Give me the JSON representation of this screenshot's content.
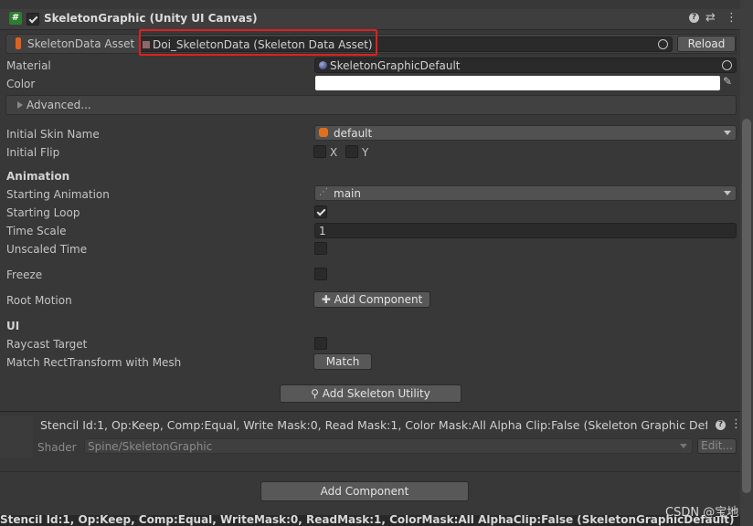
{
  "header": {
    "component_title": "SkeletonGraphic (Unity UI Canvas)",
    "enabled": true,
    "help_icon": "help-icon",
    "preset_icon": "preset-icon",
    "menu_icon": "kebab-menu-icon"
  },
  "skeleton_data": {
    "label": "SkeletonData Asset",
    "value": "Doi_SkeletonData (Skeleton Data Asset)",
    "reload_label": "Reload"
  },
  "material": {
    "label": "Material",
    "value": "SkeletonGraphicDefault"
  },
  "color": {
    "label": "Color",
    "value": "#ffffff"
  },
  "advanced": {
    "label": "Advanced..."
  },
  "skin": {
    "label": "Initial Skin Name",
    "value": "default"
  },
  "flip": {
    "label": "Initial Flip",
    "x_label": "X",
    "y_label": "Y"
  },
  "animation_section": {
    "title": "Animation"
  },
  "starting_animation": {
    "label": "Starting Animation",
    "value": "main"
  },
  "starting_loop": {
    "label": "Starting Loop",
    "checked": true
  },
  "time_scale": {
    "label": "Time Scale",
    "value": "1"
  },
  "unscaled_time": {
    "label": "Unscaled Time",
    "checked": false
  },
  "freeze": {
    "label": "Freeze",
    "checked": false
  },
  "root_motion": {
    "label": "Root Motion",
    "button_label": "Add Component"
  },
  "ui_section": {
    "title": "UI"
  },
  "raycast_target": {
    "label": "Raycast Target",
    "checked": false
  },
  "match_rect": {
    "label": "Match RectTransform with Mesh",
    "button_label": "Match"
  },
  "skeleton_utility": {
    "button_label": "Add Skeleton Utility"
  },
  "material_panel": {
    "title": "Stencil Id:1, Op:Keep, Comp:Equal, Write Mask:0, Read Mask:1, Color Mask:All Alpha Clip:False (Skeleton Graphic Def",
    "shader_label": "Shader",
    "shader_value": "Spine/SkeletonGraphic",
    "edit_label": "Edit..."
  },
  "add_component": {
    "label": "Add Component"
  },
  "footer": {
    "status_text": "Stencil Id:1, Op:Keep, Comp:Equal, WriteMask:0, ReadMask:1, ColorMask:All AlphaClip:False (SkeletonGraphicDefault)",
    "watermark": "CSDN @宝地"
  },
  "colors": {
    "panel": "#383838",
    "field": "#2a2a2a",
    "highlight_box": "#e02020",
    "header": "#3e3e3e"
  }
}
